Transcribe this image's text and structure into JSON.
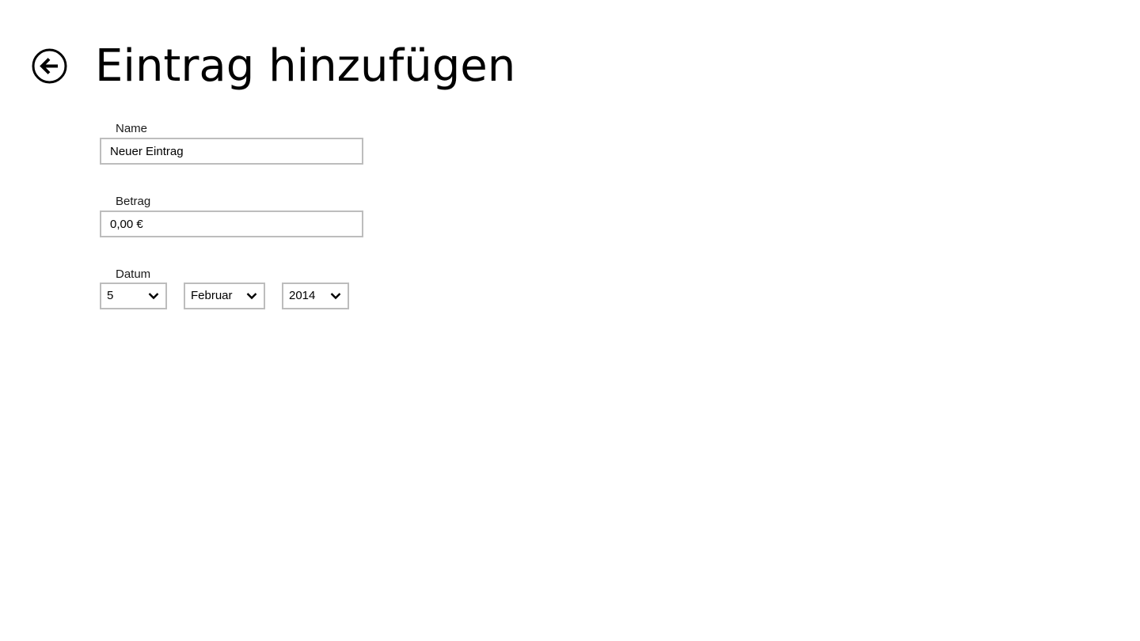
{
  "header": {
    "title": "Eintrag hinzufügen",
    "back_icon": "back-arrow-circle-icon"
  },
  "form": {
    "name": {
      "label": "Name",
      "value": "Neuer Eintrag"
    },
    "amount": {
      "label": "Betrag",
      "value": "0,00 €"
    },
    "date": {
      "label": "Datum",
      "day": "5",
      "month": "Februar",
      "year": "2014",
      "dropdown_icon": "chevron-down-icon"
    }
  },
  "colors": {
    "background": "#ffffff",
    "text": "#000000",
    "input_border": "#bdbdbd"
  }
}
